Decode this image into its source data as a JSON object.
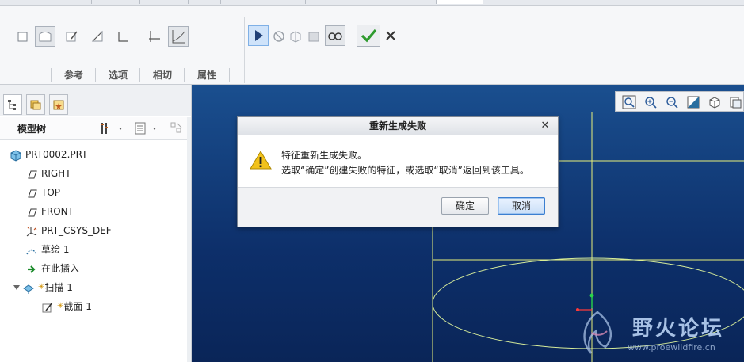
{
  "ribbon": {
    "group_labels": [
      "参考",
      "选项",
      "相切",
      "属性"
    ]
  },
  "panel": {
    "tree_title": "模型树",
    "items": [
      {
        "label": "PRT0002.PRT",
        "icon": "part-icon"
      },
      {
        "label": "RIGHT",
        "icon": "datum-plane-icon"
      },
      {
        "label": "TOP",
        "icon": "datum-plane-icon"
      },
      {
        "label": "FRONT",
        "icon": "datum-plane-icon"
      },
      {
        "label": "PRT_CSYS_DEF",
        "icon": "csys-icon"
      },
      {
        "label": "草绘 1",
        "icon": "sketch-icon"
      },
      {
        "label": "在此插入",
        "icon": "insert-arrow-icon"
      },
      {
        "label": "扫描 1",
        "icon": "sweep-icon"
      },
      {
        "label": "截面 1",
        "icon": "section-icon"
      }
    ]
  },
  "dialog": {
    "title": "重新生成失败",
    "message_line1": "特征重新生成失败。",
    "message_line2": "选取“确定”创建失败的特征，或选取“取消”返回到该工具。",
    "ok_label": "确定",
    "cancel_label": "取消"
  },
  "watermark": {
    "title": "野火论坛",
    "url": "www.proewildfire.cn"
  },
  "colors": {
    "viewport_top": "#1a4f8f",
    "viewport_bottom": "#0a2558",
    "sketch_line": "#e8f07a",
    "check_green": "#2e9a2e",
    "warning_yellow": "#f2c21b"
  }
}
